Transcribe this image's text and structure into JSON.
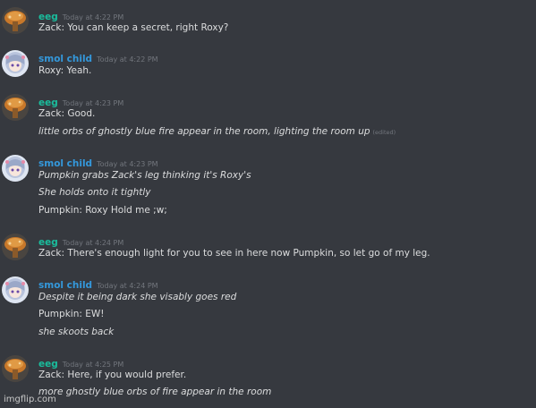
{
  "users": {
    "eeg": {
      "name": "eeg",
      "color": "#1abc9c",
      "avatar_icon": "mushroom-avatar-icon"
    },
    "smol": {
      "name": "smol child",
      "color": "#3498db",
      "avatar_icon": "anime-girl-avatar-icon"
    }
  },
  "messages": [
    {
      "user": "eeg",
      "timestamp": "Today at 4:22 PM",
      "lines": [
        {
          "text": "Zack: You can keep a secret, right Roxy?",
          "italic": false
        }
      ]
    },
    {
      "user": "smol child",
      "timestamp": "Today at 4:22 PM",
      "lines": [
        {
          "text": "Roxy: Yeah.",
          "italic": false
        }
      ]
    },
    {
      "user": "eeg",
      "timestamp": "Today at 4:23 PM",
      "lines": [
        {
          "text": "Zack: Good.",
          "italic": false
        },
        {
          "text": "little orbs of ghostly blue fire appear in the room, lighting the room up",
          "italic": true,
          "edited": "(edited)"
        }
      ]
    },
    {
      "user": "smol child",
      "timestamp": "Today at 4:23 PM",
      "lines": [
        {
          "text": "Pumpkin grabs Zack's leg thinking it's Roxy's",
          "italic": true
        },
        {
          "text": "She holds onto it tightly",
          "italic": true
        },
        {
          "text": "Pumpkin: Roxy Hold me ;w;",
          "italic": false
        }
      ]
    },
    {
      "user": "eeg",
      "timestamp": "Today at 4:24 PM",
      "lines": [
        {
          "text": "Zack: There's enough light for you to see in here now Pumpkin, so let go of my leg.",
          "italic": false
        }
      ]
    },
    {
      "user": "smol child",
      "timestamp": "Today at 4:24 PM",
      "lines": [
        {
          "text": "Despite it being dark she visably goes red",
          "italic": true
        },
        {
          "text": "Pumpkin: EW!",
          "italic": false
        },
        {
          "text": "she skoots back",
          "italic": true
        }
      ]
    },
    {
      "user": "eeg",
      "timestamp": "Today at 4:25 PM",
      "lines": [
        {
          "text": "Zack: Here, if you would prefer.",
          "italic": false
        },
        {
          "text": "more ghostly blue orbs of fire appear in the room",
          "italic": true
        }
      ]
    }
  ],
  "watermark": "imgflip.com"
}
